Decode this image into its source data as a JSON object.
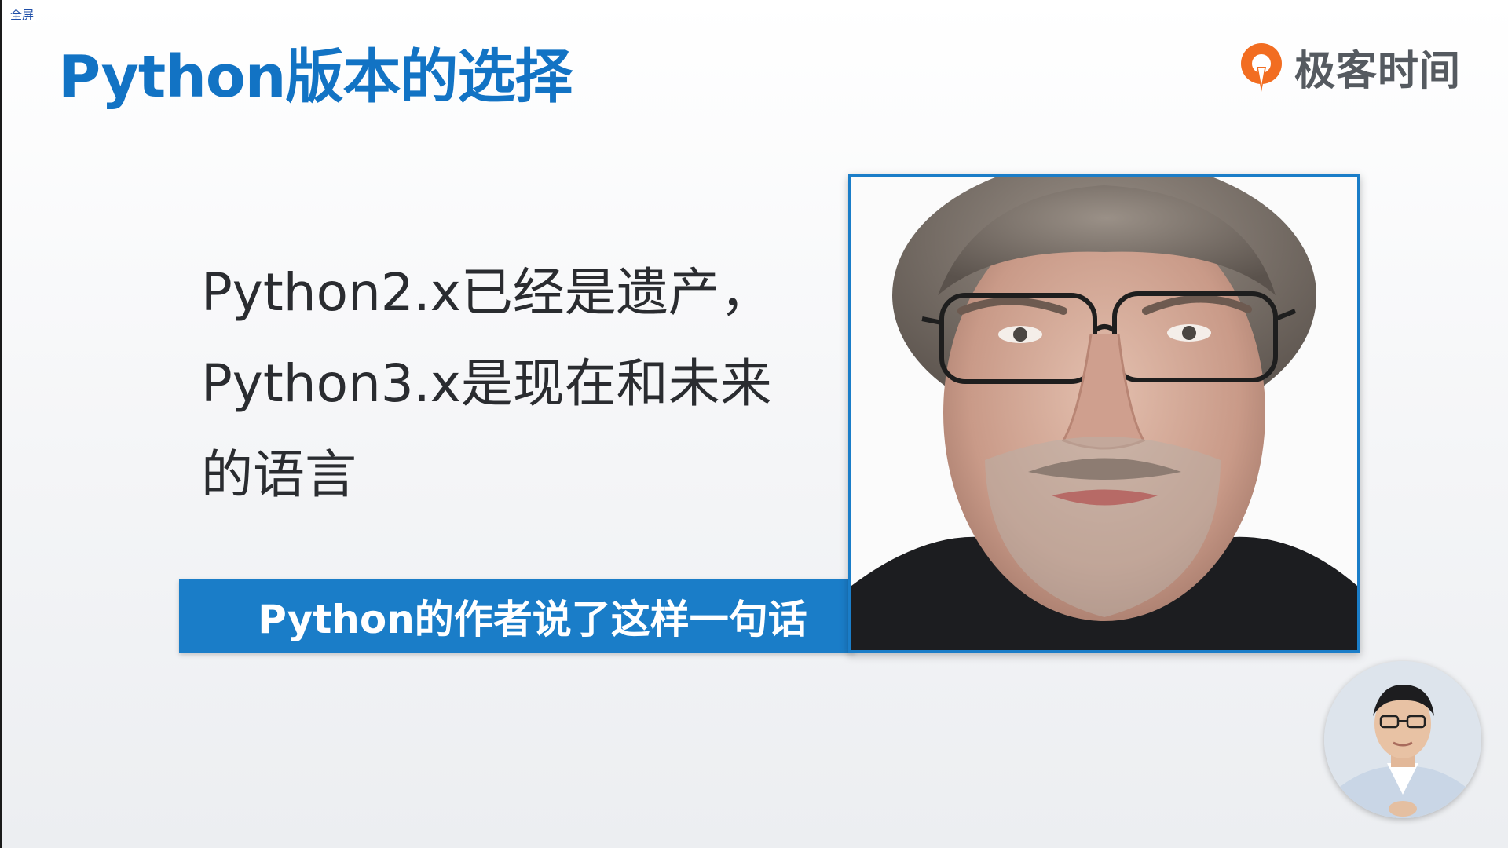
{
  "player": {
    "fullscreen_label": "全屏"
  },
  "slide": {
    "title": "Python版本的选择",
    "brand": {
      "name": "极客时间",
      "logo_icon": "geektime-logo-icon",
      "logo_color": "#f26d21"
    },
    "main_text_lines": [
      "Python2.x已经是遗产，",
      "Python3.x是现在和未来",
      "的语言"
    ],
    "caption": "Python的作者说了这样一句话",
    "portrait_icon": "author-portrait-photo",
    "presenter_icon": "presenter-video-thumbnail"
  },
  "colors": {
    "title": "#1273c4",
    "caption_bar": "#1a7dc8",
    "text": "#2a2c30",
    "brand_text": "#555a60"
  }
}
